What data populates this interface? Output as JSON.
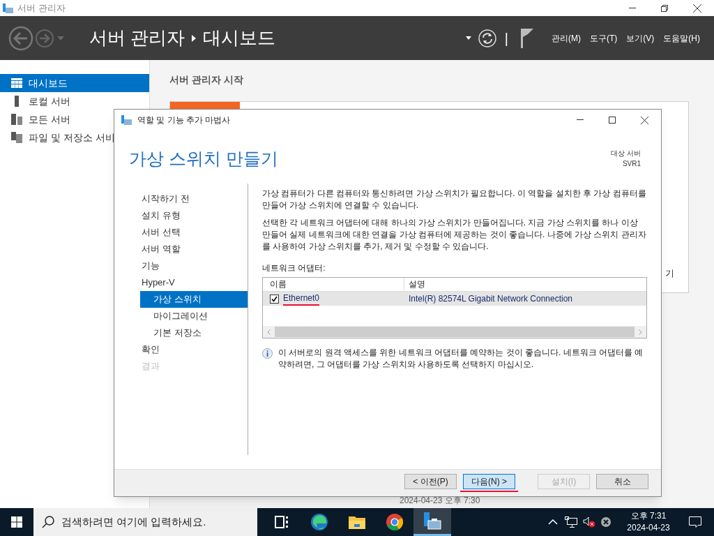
{
  "window": {
    "title": "서버 관리자"
  },
  "header": {
    "breadcrumb": [
      "서버 관리자",
      "대시보드"
    ],
    "separator": "|",
    "menus": [
      "관리(M)",
      "도구(T)",
      "보기(V)",
      "도움말(H)"
    ]
  },
  "sidebar": {
    "items": [
      {
        "label": "대시보드",
        "selected": true
      },
      {
        "label": "로컬 서버",
        "selected": false
      },
      {
        "label": "모든 서버",
        "selected": false
      },
      {
        "label": "파일 및 저장소 서비",
        "selected": false
      }
    ]
  },
  "main": {
    "heading": "서버 관리자 시작",
    "card_fragment": "기",
    "timestamp": "2024-04-23 오후 7:30"
  },
  "dialog": {
    "title": "역할 및 기능 추가 마법사",
    "heading": "가상 스위치 만들기",
    "target_label": "대상 서버",
    "target_value": "SVR1",
    "steps": [
      {
        "label": "시작하기 전",
        "selected": false,
        "disabled": false
      },
      {
        "label": "설치 유형",
        "selected": false,
        "disabled": false
      },
      {
        "label": "서버 선택",
        "selected": false,
        "disabled": false
      },
      {
        "label": "서버 역할",
        "selected": false,
        "disabled": false
      },
      {
        "label": "기능",
        "selected": false,
        "disabled": false
      },
      {
        "label": "Hyper-V",
        "selected": false,
        "disabled": false,
        "children": [
          {
            "label": "가상 스위치",
            "selected": true,
            "disabled": false
          },
          {
            "label": "마이그레이션",
            "selected": false,
            "disabled": false
          },
          {
            "label": "기본 저장소",
            "selected": false,
            "disabled": false
          }
        ]
      },
      {
        "label": "확인",
        "selected": false,
        "disabled": false
      },
      {
        "label": "결과",
        "selected": false,
        "disabled": true
      }
    ],
    "paragraphs": [
      "가상 컴퓨터가 다른 컴퓨터와 통신하려면 가상 스위치가 필요합니다. 이 역할을 설치한 후 가상 컴퓨터를 만들어 가상 스위치에 연결할 수 있습니다.",
      "선택한 각 네트워크 어댑터에 대해 하나의 가상 스위치가 만들어집니다. 지금 가상 스위치를 하나 이상 만들어 실제 네트워크에 대한 연결을 가상 컴퓨터에 제공하는 것이 좋습니다. 나중에 가상 스위치 관리자를 사용하여 가상 스위치를 추가, 제거 및 수정할 수 있습니다."
    ],
    "adapters_label": "네트워크 어댑터:",
    "adapters": {
      "columns": [
        "이름",
        "설명"
      ],
      "rows": [
        {
          "name": "Ethernet0",
          "description": "Intel(R) 82574L Gigabit Network Connection",
          "checked": true,
          "selected": true,
          "underlined": true
        }
      ]
    },
    "info": "이 서버로의 원격 액세스를 위한 네트워크 어댑터를 예약하는 것이 좋습니다. 네트워크 어댑터를 예약하려면, 그 어댑터를 가상 스위치와 사용하도록 선택하지 마십시오.",
    "buttons": [
      {
        "label": "< 이전(P)",
        "focused": false,
        "disabled": false
      },
      {
        "label": "다음(N) >",
        "focused": true,
        "disabled": false,
        "underlined": true
      },
      {
        "label": "설치(I)",
        "focused": false,
        "disabled": true
      },
      {
        "label": "취소",
        "focused": false,
        "disabled": false
      }
    ]
  },
  "taskbar": {
    "search_placeholder": "검색하려면 여기에 입력하세요.",
    "apps": [
      {
        "active": false
      },
      {
        "active": false
      },
      {
        "active": false
      },
      {
        "active": false
      },
      {
        "active": true
      }
    ],
    "time": "오후 7:31",
    "date": "2024-04-23"
  }
}
